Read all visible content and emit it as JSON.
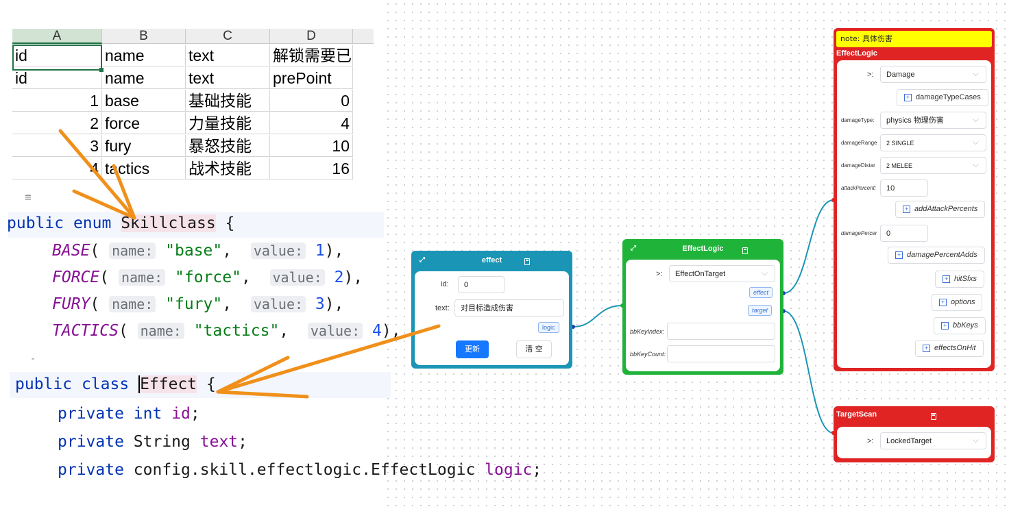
{
  "sheet": {
    "columns": [
      "A",
      "B",
      "C",
      "D"
    ],
    "rows": [
      [
        "id",
        "name",
        "text",
        "解锁需要已投"
      ],
      [
        "id",
        "name",
        "text",
        "prePoint"
      ],
      [
        "1",
        "base",
        "基础技能",
        "0"
      ],
      [
        "2",
        "force",
        "力量技能",
        "4"
      ],
      [
        "3",
        "fury",
        "暴怒技能",
        "10"
      ],
      [
        "4",
        "tactics",
        "战术技能",
        "16"
      ]
    ]
  },
  "enum_code": {
    "menu_glyph": "≡",
    "line1": [
      "public",
      "enum",
      "Skillclass",
      "{"
    ],
    "hint_name": "name:",
    "hint_value": "value:",
    "entries": [
      {
        "name": "BASE",
        "str": "\"base\"",
        "num": "1"
      },
      {
        "name": "FORCE",
        "str": "\"force\"",
        "num": "2"
      },
      {
        "name": "FURY",
        "str": "\"fury\"",
        "num": "3"
      },
      {
        "name": "TACTICS",
        "str": "\"tactics\"",
        "num": "4"
      }
    ]
  },
  "class_code": {
    "line1": [
      "public",
      "class",
      "Effect",
      "{"
    ],
    "fields": [
      {
        "kw": "private",
        "type": "int",
        "name": "id"
      },
      {
        "kw": "private",
        "type": "String",
        "name": "text"
      },
      {
        "kw": "private",
        "type": "config.skill.effectlogic.EffectLogic",
        "name": "logic"
      }
    ]
  },
  "effect_node": {
    "title": "effect",
    "id_label": "id:",
    "id_value": "0",
    "text_label": "text:",
    "text_value": "对目标造成伤害",
    "logic_tag": "logic",
    "update_button": "更新",
    "clear_button": "清 空"
  },
  "logic_node": {
    "title": "EffectLogic",
    "selector_label": ">:",
    "selector_value": "EffectOnTarget",
    "tags": [
      "effect",
      "target"
    ],
    "bbKeyIndex_label": "bbKeyIndex:",
    "bbKeyCount_label": "bbKeyCount:"
  },
  "damage_node": {
    "note": "note: 具体伤害",
    "title": "EffectLogic",
    "selector_label": ">:",
    "selector_value": "Damage",
    "damageTypeCases": "damageTypeCases",
    "damageType_label": "damageType:",
    "damageType_value": "physics 物理伤害",
    "damageRange_label": "damageRange",
    "damageRange_value": "2 SINGLE",
    "damageDistance_label": "damageDistar",
    "damageDistance_value": "2 MELEE",
    "attackPercent_label": "attackPercent:",
    "attackPercent_value": "10",
    "addAttackPercents": "addAttackPercents",
    "damagePercent_label": "damagePercer",
    "damagePercent_value": "0",
    "damagePercentAdds": "damagePercentAdds",
    "hitSfxs": "hitSfxs",
    "options": "options",
    "bbKeys": "bbKeys",
    "effectsOnHit": "effectsOnHit"
  },
  "target_node": {
    "title": "TargetScan",
    "selector_label": ">:",
    "selector_value": "LockedTarget"
  },
  "colors": {
    "effect_node": "#1a95b5",
    "logic_node": "#1fb33a",
    "damage_node": "#e02424",
    "note_bg": "#ffff00",
    "arrow": "#f0901a",
    "wire": "#1a95b5",
    "update_button": "#1677ff"
  }
}
